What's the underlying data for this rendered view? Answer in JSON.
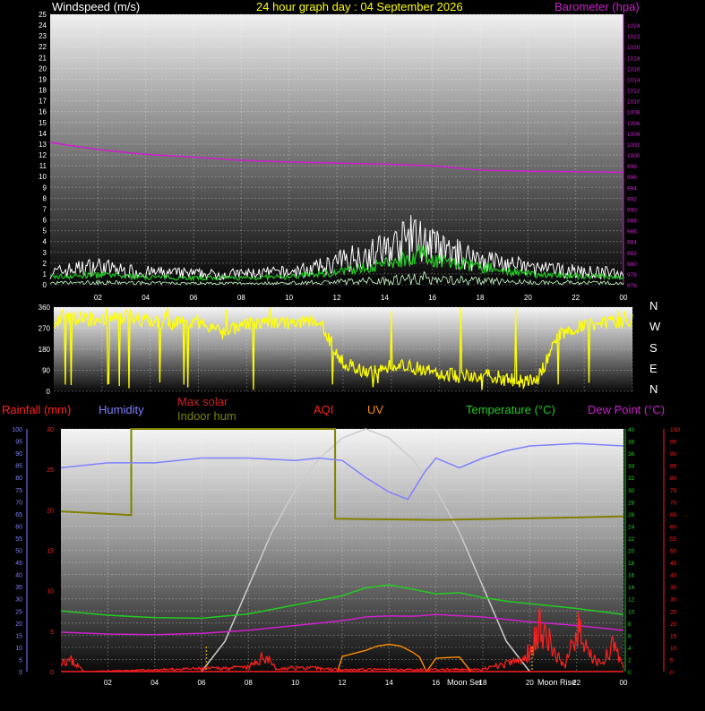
{
  "header": {
    "left_title": "Windspeed (m/s)",
    "center_title": "24 hour graph day : 04 September 2026",
    "right_title": "Barometer (hpa)"
  },
  "direction_labels": [
    "N",
    "W",
    "S",
    "E",
    "N"
  ],
  "legend": {
    "rainfall": "Rainfall (mm)",
    "humidity": "Humidity",
    "max_solar": "Max solar",
    "indoor_hum": "Indoor hum",
    "aqi": "AQI",
    "uv": "UV",
    "temperature": "Temperature (°C)",
    "dew_point": "Dew Point (°C)"
  },
  "markers": {
    "moon_set": "Moon Set",
    "moon_rise": "Moon Rise"
  },
  "colors": {
    "background": "#000000",
    "wind_gust": "#ffffff",
    "wind_avg": "#22cc22",
    "barometer": "#cc22cc",
    "direction": "#ffff00",
    "rainfall": "#ff2020",
    "humidity": "#8080ff",
    "max_solar": "#cccccc",
    "indoor_hum": "#808000",
    "uv": "#ff8c00",
    "temperature": "#22cc22",
    "dew_point": "#cc22cc",
    "axis_left": "#8080ff",
    "axis_right_green": "#22cc22",
    "axis_right_red": "#ff2020"
  },
  "chart_data": [
    {
      "type": "line",
      "name": "wind",
      "x_ticks": [
        "02",
        "04",
        "06",
        "08",
        "10",
        "12",
        "14",
        "16",
        "18",
        "20",
        "22",
        "00"
      ],
      "y_left_range": [
        0,
        25
      ],
      "y_left_ticks": [
        "0",
        "1",
        "2",
        "3",
        "4",
        "5",
        "6",
        "7",
        "8",
        "9",
        "10",
        "11",
        "12",
        "13",
        "14",
        "15",
        "16",
        "17",
        "18",
        "19",
        "20",
        "21",
        "22",
        "23",
        "24",
        "25"
      ],
      "y_right_range": [
        976,
        1026
      ],
      "y_right_ticks": [
        "976",
        "978",
        "980",
        "982",
        "984",
        "986",
        "988",
        "990",
        "992",
        "994",
        "996",
        "998",
        "1000",
        "1002",
        "1004",
        "1006",
        "1008",
        "1010",
        "1012",
        "1014",
        "1016",
        "1018",
        "1020",
        "1022",
        "1024"
      ],
      "barometer_points": [
        [
          0,
          1002.3
        ],
        [
          2,
          1001.0
        ],
        [
          4,
          1000.1
        ],
        [
          6,
          999.6
        ],
        [
          8,
          999.0
        ],
        [
          10,
          998.7
        ],
        [
          12,
          998.5
        ],
        [
          14,
          998.3
        ],
        [
          16,
          998.0
        ],
        [
          18,
          997.2
        ],
        [
          20,
          997.0
        ],
        [
          22,
          996.9
        ],
        [
          24,
          996.8
        ]
      ],
      "wind_gust_envelope": [
        [
          0,
          1.5
        ],
        [
          1,
          2.0
        ],
        [
          2,
          2.4
        ],
        [
          3,
          1.8
        ],
        [
          4,
          1.6
        ],
        [
          5,
          1.5
        ],
        [
          6,
          1.4
        ],
        [
          7,
          1.3
        ],
        [
          8,
          1.4
        ],
        [
          9,
          1.5
        ],
        [
          10,
          1.6
        ],
        [
          11,
          2.0
        ],
        [
          11.8,
          2.6
        ],
        [
          12.5,
          3.4
        ],
        [
          13.5,
          4.0
        ],
        [
          14.5,
          5.0
        ],
        [
          15.2,
          6.1
        ],
        [
          15.8,
          5.3
        ],
        [
          16.5,
          4.2
        ],
        [
          17.5,
          3.6
        ],
        [
          18.5,
          3.0
        ],
        [
          19.5,
          2.4
        ],
        [
          20.5,
          2.0
        ],
        [
          21.5,
          1.8
        ],
        [
          22.5,
          1.6
        ],
        [
          24,
          1.5
        ]
      ],
      "wind_avg_envelope": [
        [
          0,
          0.8
        ],
        [
          2,
          1.0
        ],
        [
          4,
          0.8
        ],
        [
          6,
          0.7
        ],
        [
          8,
          0.7
        ],
        [
          10,
          0.8
        ],
        [
          12,
          1.3
        ],
        [
          13,
          1.7
        ],
        [
          14,
          2.1
        ],
        [
          15,
          2.8
        ],
        [
          15.5,
          3.3
        ],
        [
          16,
          2.6
        ],
        [
          17,
          2.2
        ],
        [
          18,
          1.8
        ],
        [
          19,
          1.5
        ],
        [
          20,
          1.1
        ],
        [
          22,
          0.9
        ],
        [
          24,
          0.8
        ]
      ]
    },
    {
      "type": "line",
      "name": "wind direction",
      "x_ticks": [
        "02",
        "04",
        "06",
        "08",
        "10",
        "12",
        "14",
        "16",
        "18",
        "20",
        "22",
        "00"
      ],
      "y_range": [
        0,
        360
      ],
      "y_ticks": [
        "0",
        "90",
        "180",
        "270",
        "360"
      ],
      "direction_points": [
        [
          0,
          300
        ],
        [
          1,
          310
        ],
        [
          2,
          300
        ],
        [
          3,
          320
        ],
        [
          4,
          300
        ],
        [
          5,
          290
        ],
        [
          6,
          300
        ],
        [
          7,
          250
        ],
        [
          8,
          290
        ],
        [
          9,
          300
        ],
        [
          10,
          290
        ],
        [
          11,
          300
        ],
        [
          12,
          120
        ],
        [
          13,
          80
        ],
        [
          14,
          110
        ],
        [
          15,
          100
        ],
        [
          16,
          80
        ],
        [
          17,
          60
        ],
        [
          18,
          70
        ],
        [
          19,
          50
        ],
        [
          20,
          40
        ],
        [
          21,
          250
        ],
        [
          22,
          280
        ],
        [
          23,
          300
        ],
        [
          24,
          300
        ]
      ]
    },
    {
      "type": "line",
      "name": "temperature and solar",
      "x_ticks": [
        "02",
        "04",
        "06",
        "08",
        "10",
        "12",
        "14",
        "16",
        "18",
        "20",
        "22",
        "00"
      ],
      "y_left_outer_range": [
        0,
        100
      ],
      "y_left_outer_ticks": [
        "0",
        "5",
        "10",
        "15",
        "20",
        "25",
        "30",
        "35",
        "40",
        "45",
        "50",
        "55",
        "60",
        "65",
        "70",
        "75",
        "80",
        "85",
        "90",
        "95",
        "100"
      ],
      "y_left_inner_range": [
        0,
        30
      ],
      "y_left_inner_ticks": [
        "0",
        "5",
        "10",
        "15",
        "20",
        "25",
        "30"
      ],
      "y_right_green_range": [
        0,
        40
      ],
      "y_right_green_ticks": [
        "0",
        "2",
        "4",
        "6",
        "8",
        "10",
        "12",
        "14",
        "16",
        "18",
        "20",
        "22",
        "24",
        "26",
        "28",
        "30",
        "32",
        "34",
        "36",
        "38",
        "40"
      ],
      "y_right_red_range": [
        0,
        100
      ],
      "y_right_red_ticks": [
        "0",
        "5",
        "10",
        "15",
        "20",
        "25",
        "30",
        "35",
        "40",
        "45",
        "50",
        "55",
        "60",
        "65",
        "70",
        "75",
        "80",
        "85",
        "90",
        "95",
        "100"
      ],
      "humidity_points": [
        [
          0,
          84
        ],
        [
          2,
          86
        ],
        [
          4,
          86
        ],
        [
          6,
          88
        ],
        [
          8,
          88
        ],
        [
          10,
          87
        ],
        [
          11,
          88
        ],
        [
          12,
          87
        ],
        [
          13,
          80
        ],
        [
          14,
          74
        ],
        [
          14.8,
          71
        ],
        [
          15.5,
          82
        ],
        [
          16,
          88
        ],
        [
          17,
          84
        ],
        [
          18,
          88
        ],
        [
          19,
          91
        ],
        [
          20,
          93
        ],
        [
          22,
          94
        ],
        [
          24,
          93
        ]
      ],
      "temperature_points": [
        [
          0,
          10
        ],
        [
          2,
          9.3
        ],
        [
          4,
          8.9
        ],
        [
          6,
          8.8
        ],
        [
          8,
          9.5
        ],
        [
          10,
          11
        ],
        [
          12,
          12.5
        ],
        [
          13,
          13.8
        ],
        [
          14,
          14.3
        ],
        [
          15,
          13.6
        ],
        [
          16,
          12.8
        ],
        [
          17,
          13.0
        ],
        [
          18,
          12.2
        ],
        [
          19,
          11.6
        ],
        [
          20,
          11.2
        ],
        [
          22,
          10.4
        ],
        [
          24,
          9.4
        ]
      ],
      "dew_point_points": [
        [
          0,
          6.5
        ],
        [
          2,
          6.2
        ],
        [
          4,
          6.1
        ],
        [
          6,
          6.3
        ],
        [
          8,
          6.8
        ],
        [
          10,
          7.6
        ],
        [
          12,
          8.4
        ],
        [
          13,
          9.0
        ],
        [
          14,
          9.2
        ],
        [
          15,
          9.1
        ],
        [
          16,
          9.4
        ],
        [
          18,
          9.0
        ],
        [
          19,
          8.6
        ],
        [
          20,
          8.2
        ],
        [
          22,
          7.6
        ],
        [
          24,
          6.8
        ]
      ],
      "indoor_hum_points": [
        [
          0,
          66
        ],
        [
          3,
          64.5
        ],
        [
          3,
          100
        ],
        [
          11.7,
          100
        ],
        [
          11.7,
          63
        ],
        [
          16,
          62.5
        ],
        [
          22,
          63.5
        ],
        [
          24,
          64
        ]
      ],
      "max_solar_points": [
        [
          6,
          0
        ],
        [
          7,
          5
        ],
        [
          8,
          14
        ],
        [
          9,
          23
        ],
        [
          10,
          30
        ],
        [
          11,
          35
        ],
        [
          12,
          38.5
        ],
        [
          13,
          40
        ],
        [
          14,
          38.5
        ],
        [
          15,
          35
        ],
        [
          16,
          30
        ],
        [
          17,
          23
        ],
        [
          18,
          14
        ],
        [
          19,
          5
        ],
        [
          20,
          0
        ]
      ],
      "uv_points": [
        [
          11.8,
          0
        ],
        [
          12,
          2.5
        ],
        [
          12.5,
          3
        ],
        [
          13,
          3.5
        ],
        [
          13.5,
          4.2
        ],
        [
          14,
          4.5
        ],
        [
          14.5,
          4.2
        ],
        [
          15,
          3.2
        ],
        [
          15.3,
          2.4
        ],
        [
          15.6,
          0
        ],
        [
          16,
          2.2
        ],
        [
          17,
          2.4
        ],
        [
          17.5,
          0
        ]
      ],
      "aqi_points": [
        [
          0,
          6
        ],
        [
          0.5,
          5
        ],
        [
          1,
          0
        ],
        [
          8,
          2
        ],
        [
          8.8,
          8
        ],
        [
          9.2,
          1
        ],
        [
          10,
          2
        ],
        [
          12,
          1
        ],
        [
          14,
          1
        ],
        [
          16,
          1
        ],
        [
          18,
          1
        ],
        [
          19.8,
          6
        ],
        [
          20.5,
          24
        ],
        [
          21,
          10
        ],
        [
          21.5,
          2
        ],
        [
          22,
          22
        ],
        [
          22.5,
          8
        ],
        [
          23,
          4
        ],
        [
          23.5,
          12
        ],
        [
          24,
          3
        ]
      ],
      "rainfall_points": [
        [
          0,
          0
        ],
        [
          24,
          0
        ]
      ]
    }
  ]
}
